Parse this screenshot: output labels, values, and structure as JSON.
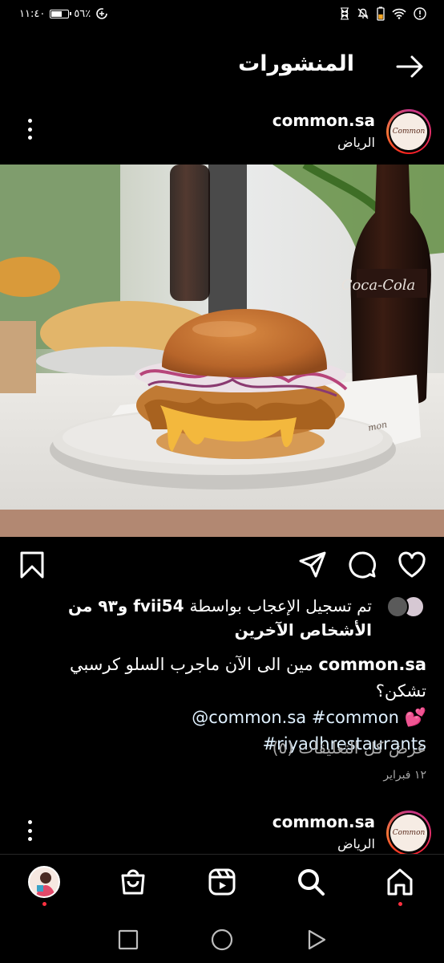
{
  "status_bar": {
    "time": "١١:٤٠",
    "battery_text": "٥٦٪",
    "battery_level": 0.56
  },
  "header": {
    "title": "المنشورات",
    "back_icon": "arrow-right-icon"
  },
  "post": {
    "username": "common.sa",
    "location": "الرياض",
    "avatar_text": "Common",
    "likes_prefix": "تم تسجيل الإعجاب بواسطة",
    "liker": "fvii54",
    "likes_suffix": "و٩٣ من الأشخاص الآخرين",
    "caption_user": "common.sa",
    "caption_text": "مين الى الآن ماجرب السلو كرسبي تشكن؟",
    "caption_tags": "@common.sa #common",
    "caption_tags2": "#riyadhrestaurants",
    "caption_emoji": "💕",
    "view_comments": "عرض كل التعليقات (٥)",
    "date": "١٢ فبراير"
  },
  "next_post": {
    "username": "common.sa",
    "location": "الرياض",
    "avatar_text": "Common"
  },
  "bottom_nav": {
    "items": [
      "profile",
      "shop",
      "reels",
      "search",
      "home"
    ]
  },
  "colors": {
    "background": "#000000",
    "notification_dot": "#ff3040",
    "secondary_text": "#a8a8a8"
  }
}
